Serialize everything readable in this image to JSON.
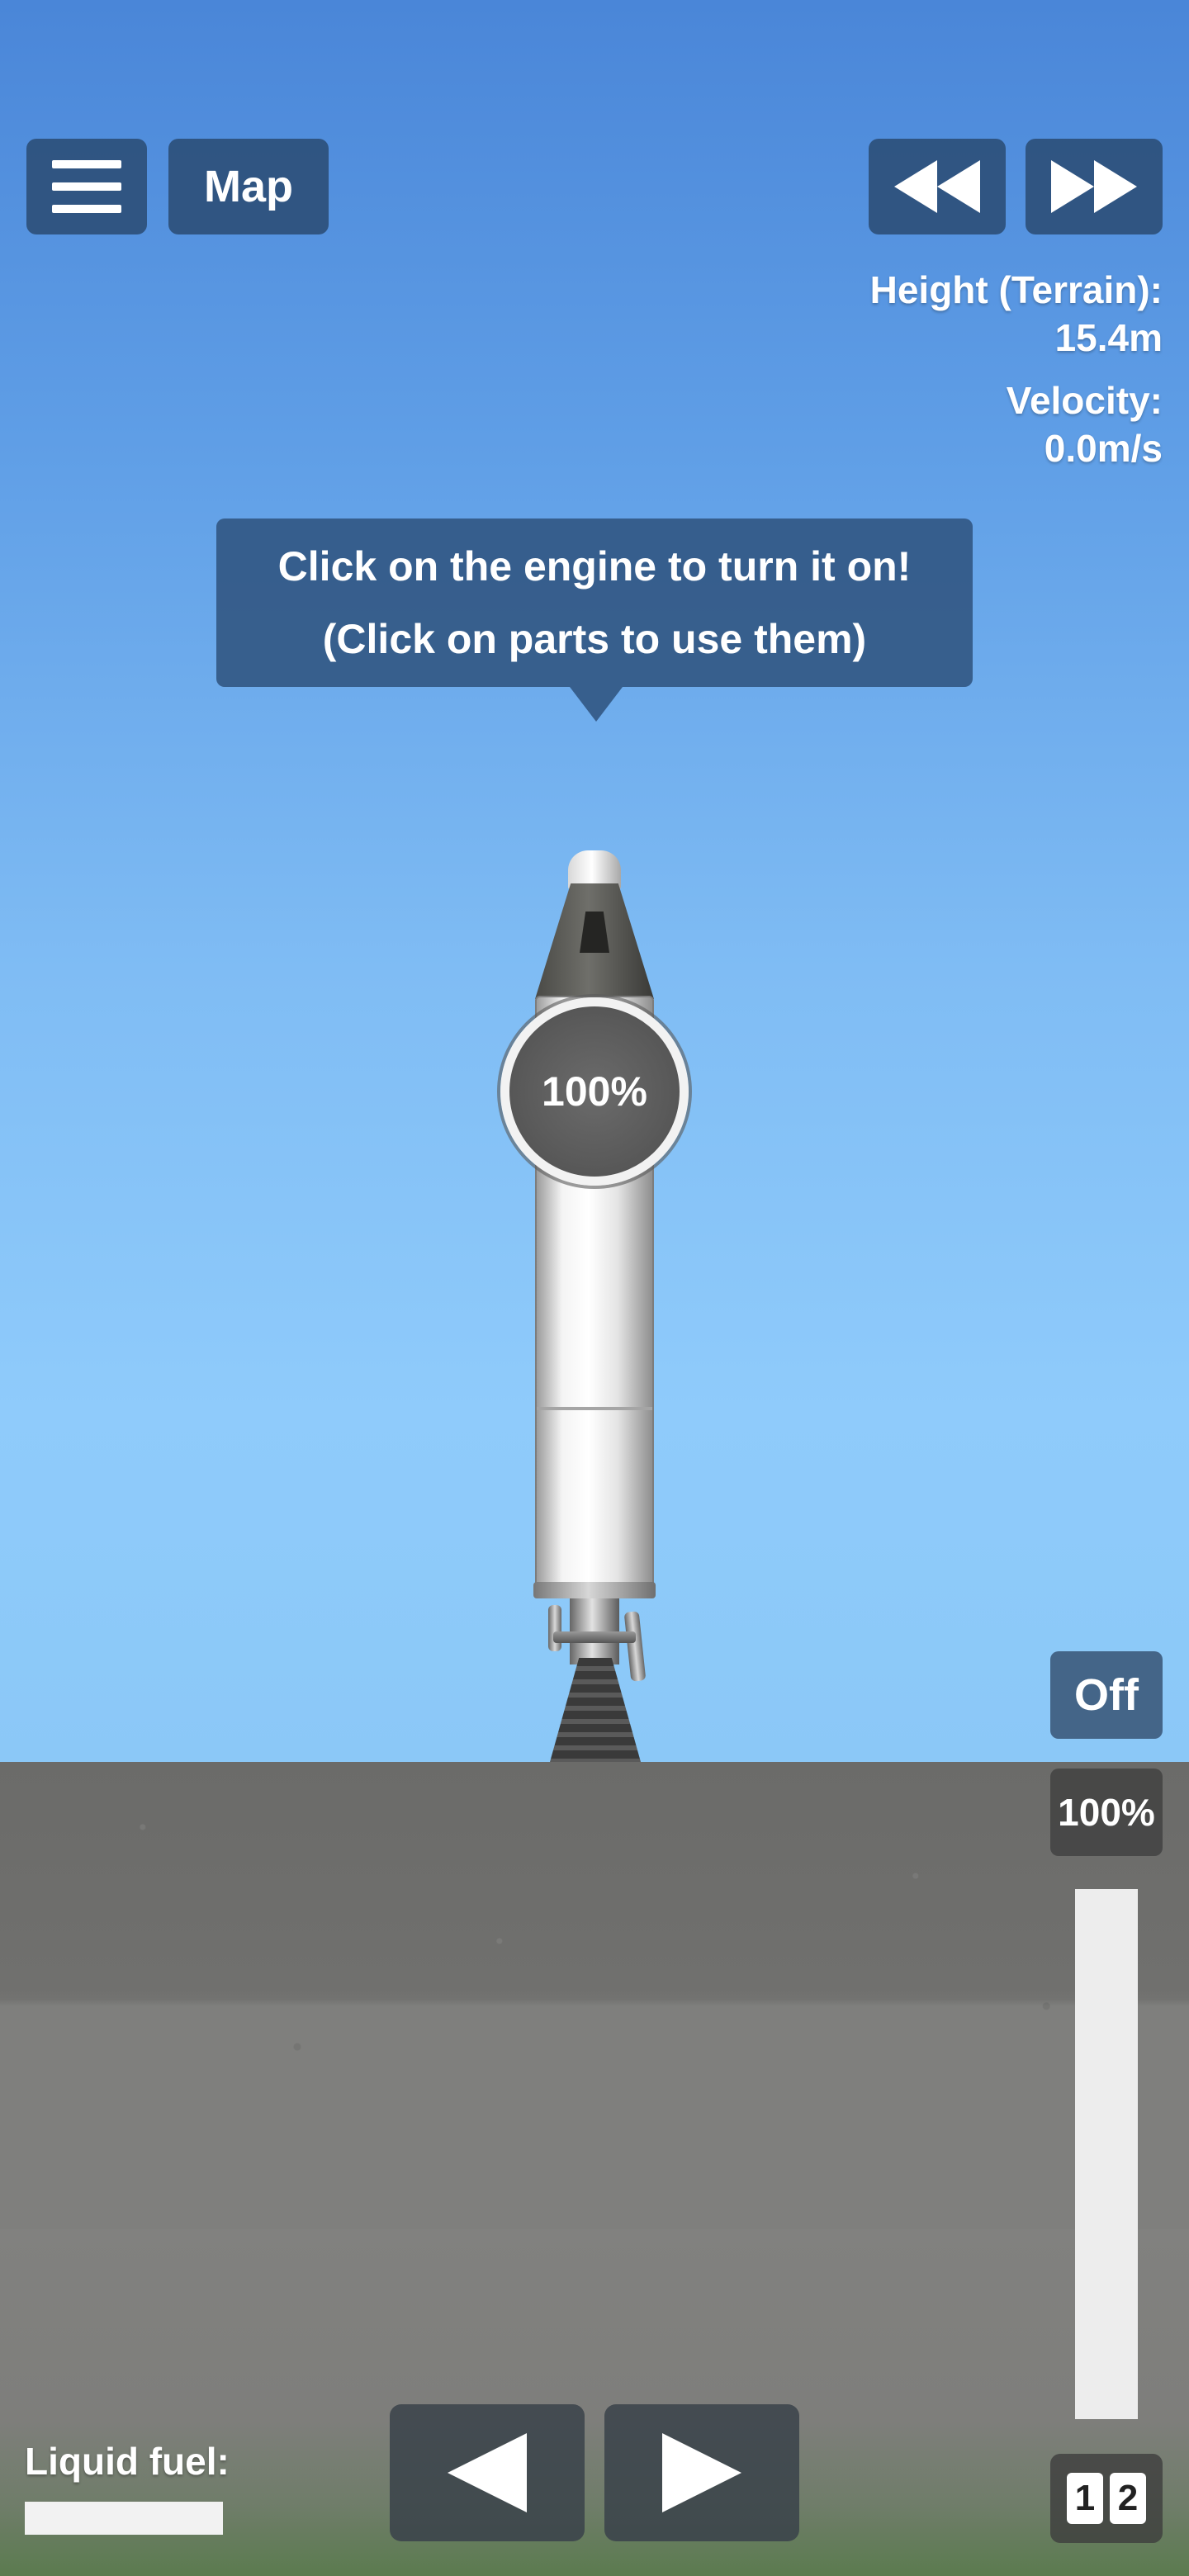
{
  "top_bar": {
    "menu_icon": "hamburger-icon",
    "map_label": "Map",
    "rewind_icon": "rewind-icon",
    "fast_forward_icon": "fast-forward-icon"
  },
  "telemetry": {
    "height_label": "Height (Terrain):",
    "height_value": "15.4m",
    "velocity_label": "Velocity:",
    "velocity_value": "0.0m/s"
  },
  "tooltip": {
    "line1": "Click on the engine to turn it on!",
    "line2": "(Click on parts to use them)"
  },
  "rocket": {
    "throttle_badge": "100%"
  },
  "controls": {
    "engine_toggle_label": "Off",
    "throttle_percent_label": "100%",
    "throttle_level": 1.0,
    "stage_numbers": [
      "1",
      "2"
    ]
  },
  "fuel": {
    "label": "Liquid fuel:",
    "level": 1.0
  },
  "rotate": {
    "left_icon": "triangle-left-icon",
    "right_icon": "triangle-right-icon"
  },
  "colors": {
    "panel": "#28486e",
    "sky_top": "#4a86d8",
    "sky_bottom": "#8bc8f7",
    "ground": "#6b6b69"
  }
}
